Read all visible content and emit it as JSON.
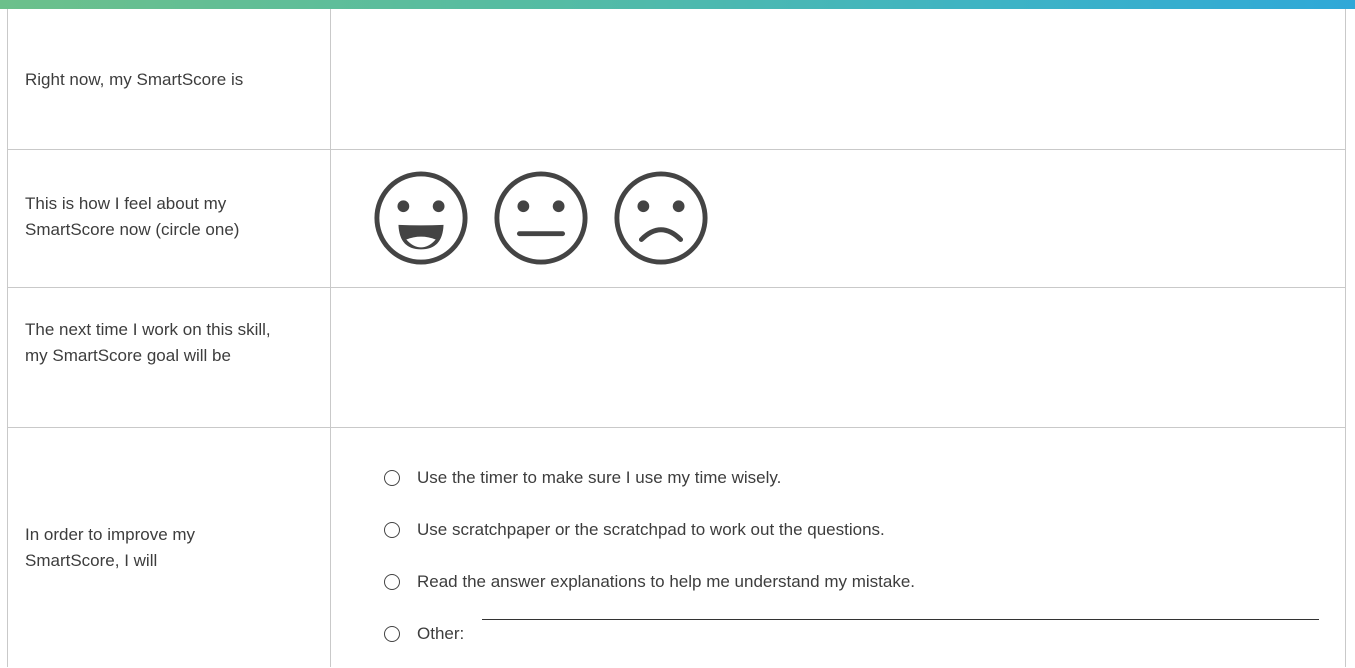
{
  "rows": {
    "smartscore_now": {
      "label": "Right now, my SmartScore is"
    },
    "feeling": {
      "label": "This is how I feel about my SmartScore now (circle one)"
    },
    "goal": {
      "label": "The next time I work on this skill, my SmartScore goal will be"
    },
    "improve": {
      "label": "In order to improve my SmartScore, I will"
    }
  },
  "faces": [
    "happy-face",
    "neutral-face",
    "sad-face"
  ],
  "options": [
    "Use the timer to make sure I use my time wisely.",
    "Use scratchpaper or the scratchpad to work out the questions.",
    "Read the answer explanations to help me understand my mistake.",
    "Other:"
  ],
  "colors": {
    "accent_start": "#6cc08b",
    "accent_end": "#2fa8d8",
    "face_stroke": "#444444",
    "grid": "#c9c9c9"
  }
}
